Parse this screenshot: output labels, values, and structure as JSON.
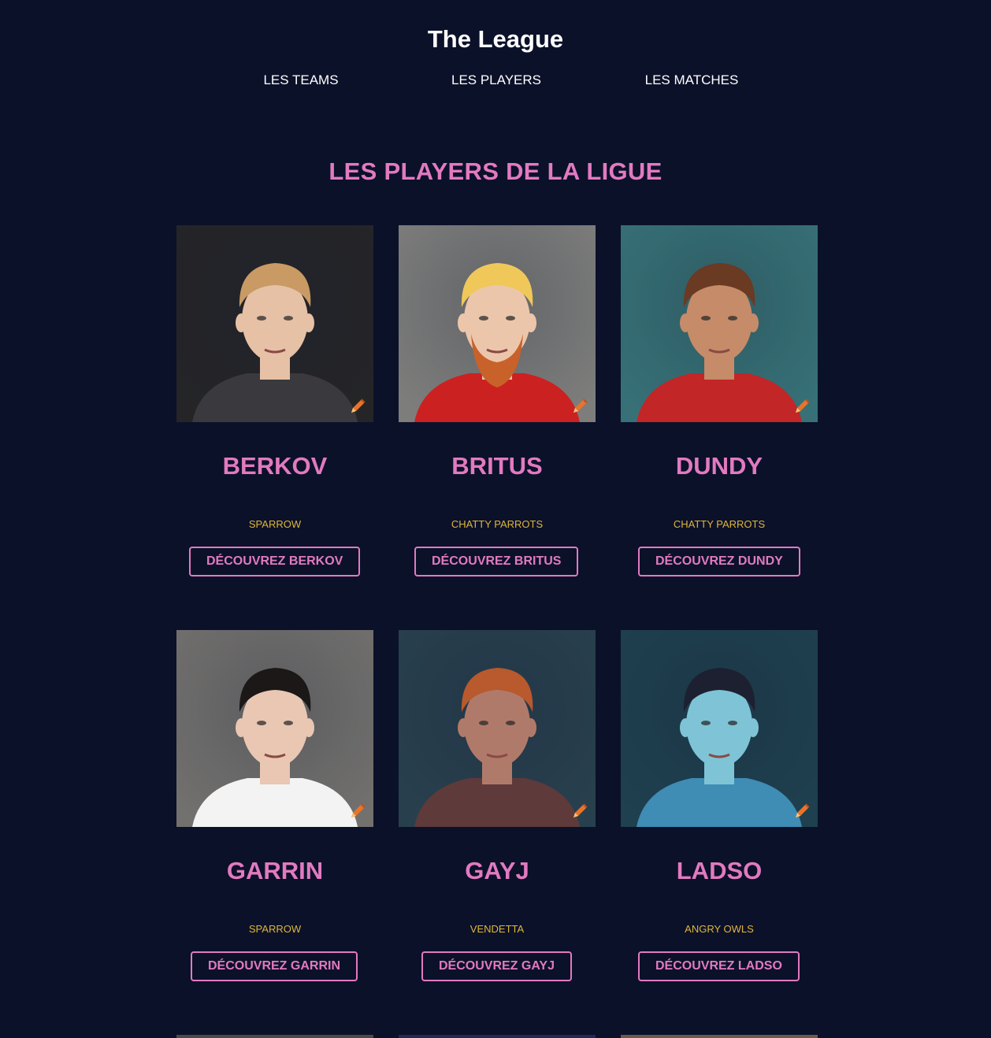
{
  "site": {
    "title": "The League"
  },
  "nav": {
    "teams": "LES TEAMS",
    "players": "LES PLAYERS",
    "matches": "LES MATCHES"
  },
  "page": {
    "heading": "LES PLAYERS DE LA LIGUE"
  },
  "colors": {
    "background": "#0b1129",
    "accent": "#e27ac0",
    "team": "#e0b53a"
  },
  "players": [
    {
      "name": "BERKOV",
      "team": "SPARROW",
      "button": "DÉCOUVREZ BERKOV",
      "photo_bg": "#1a1a1c",
      "hair": "#c99a64",
      "skin": "#e6c1a6",
      "shirt": "#3a3a3e",
      "beard": ""
    },
    {
      "name": "BRITUS",
      "team": "CHATTY PARROTS",
      "button": "DÉCOUVREZ BRITUS",
      "photo_bg": "#777775",
      "hair": "#f0c85a",
      "skin": "#ecc6ab",
      "shirt": "#cc2121",
      "beard": "#c8622a"
    },
    {
      "name": "DUNDY",
      "team": "CHATTY PARROTS",
      "button": "DÉCOUVREZ DUNDY",
      "photo_bg": "#2d6a70",
      "hair": "#6a3a22",
      "skin": "#c68b68",
      "shirt": "#c22626",
      "beard": ""
    },
    {
      "name": "GARRIN",
      "team": "SPARROW",
      "button": "DÉCOUVREZ GARRIN",
      "photo_bg": "#6c6a67",
      "hair": "#1b1817",
      "skin": "#e9c7b3",
      "shirt": "#f3f3f3",
      "beard": ""
    },
    {
      "name": "GAYJ",
      "team": "VENDETTA",
      "button": "DÉCOUVREZ GAYJ",
      "photo_bg": "#1d3645",
      "hair": "#b8592e",
      "skin": "#b07a6a",
      "shirt": "#5e3a3a",
      "beard": ""
    },
    {
      "name": "LADSO",
      "team": "ANGRY OWLS",
      "button": "DÉCOUVREZ LADSO",
      "photo_bg": "#123646",
      "hair": "#1d2030",
      "skin": "#7fc3d6",
      "shirt": "#3f8cb5",
      "beard": ""
    }
  ]
}
